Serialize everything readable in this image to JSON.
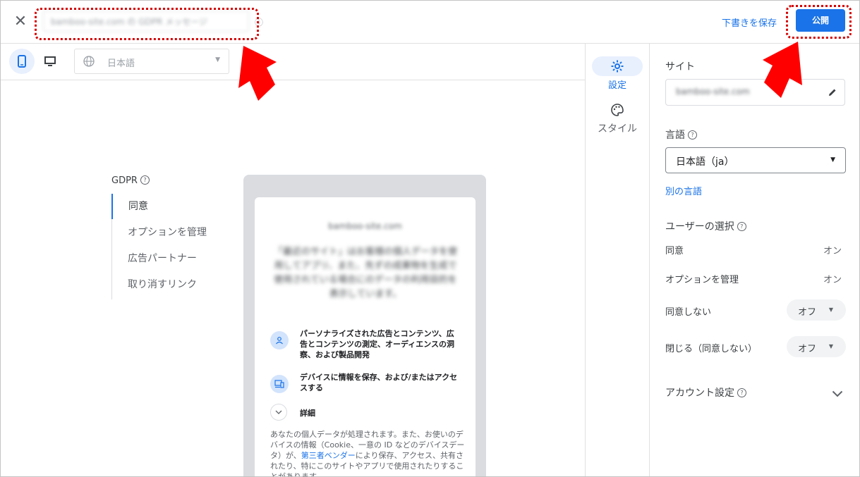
{
  "topbar": {
    "close_icon": "close-icon",
    "title_value": "bamboo-site.com の GDPR メッセージ",
    "save_draft_label": "下書きを保存",
    "publish_label": "公開"
  },
  "toolbar": {
    "language_value": "日本語"
  },
  "preview": {
    "section_title": "GDPR",
    "nav_items": [
      "同意",
      "オプションを管理",
      "広告パートナー",
      "取り消すリンク"
    ],
    "domain_blurred": "bamboo-site.com",
    "message_blurred": "「最近のサイト」はお客様の個人データを使用してアプリ、また、先ずの成果物を生成で使用されている場合にのデータの利用目的を表示しています。",
    "purpose1": "パーソナライズされた広告とコンテンツ、広告とコンテンツの測定、オーディエンスの洞察、および製品開発",
    "purpose2": "デバイスに情報を保存、および/またはアクセスする",
    "details_label": "詳細",
    "body_part1": "あなたの個人データが処理されます。また、お使いのデバイスの情報（Cookie、一意の ID などのデバイスデータ）が、",
    "body_link": "第三者ベンダー",
    "body_part2": "により保存、アクセス、共有されたり、特にこのサイトやアプリで使用されたりすることがあります。"
  },
  "side_nav": {
    "settings_label": "設定",
    "style_label": "スタイル"
  },
  "right_panel": {
    "site_label": "サイト",
    "site_value": "bamboo-site.com",
    "language_label": "言語",
    "language_value": "日本語（ja）",
    "other_language_link": "別の言語",
    "user_choice_label": "ユーザーの選択",
    "options": [
      {
        "label": "同意",
        "value": "オン"
      },
      {
        "label": "オプションを管理",
        "value": "オン"
      },
      {
        "label": "同意しない",
        "value": "オフ"
      },
      {
        "label": "閉じる（同意しない）",
        "value": "オフ"
      }
    ],
    "account_settings_label": "アカウント設定"
  },
  "colors": {
    "accent": "#1a73e8",
    "highlight": "#d40000",
    "arrow": "#ff0000"
  }
}
